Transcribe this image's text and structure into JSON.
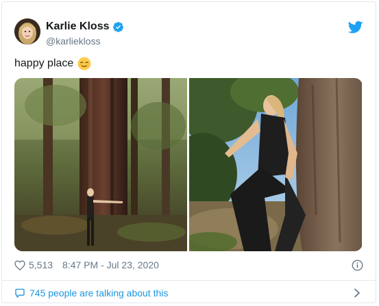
{
  "author": {
    "name": "Karlie Kloss",
    "handle": "@karliekloss",
    "verified": true
  },
  "tweet": {
    "text": "happy place",
    "emoji_icon": "relieved-face-emoji"
  },
  "media": {
    "photo_left_icon": "photo-forest-hug",
    "photo_right_icon": "photo-sitting-by-tree"
  },
  "stats": {
    "likes": "5,513",
    "timestamp": "8:47 PM - Jul 23, 2020"
  },
  "conversation": {
    "label": "745 people are talking about this"
  },
  "colors": {
    "accent": "#1da1f2",
    "link": "#1b95e0",
    "muted": "#657786",
    "border": "#e1e8ed"
  }
}
